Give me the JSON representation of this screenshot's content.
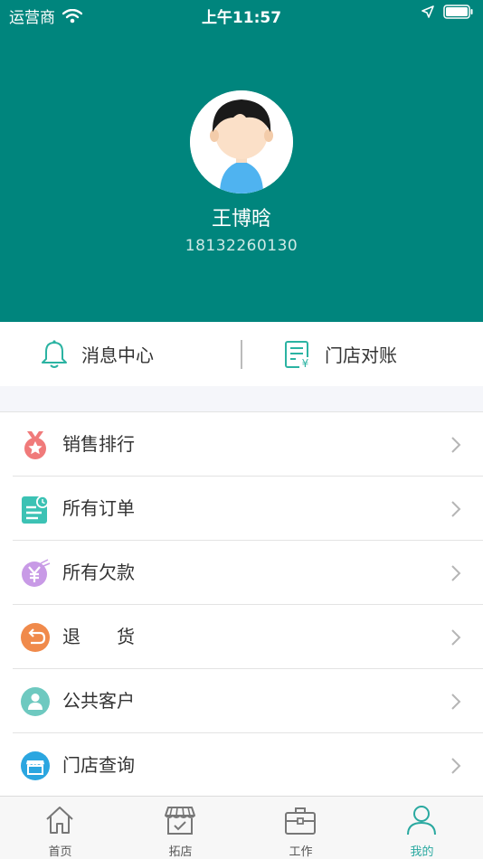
{
  "status_bar": {
    "carrier": "运营商",
    "time": "上午11:57"
  },
  "profile": {
    "name": "王博晗",
    "phone": "18132260130"
  },
  "quick_actions": [
    {
      "label": "消息中心",
      "icon": "bell-icon"
    },
    {
      "label": "门店对账",
      "icon": "statement-icon"
    }
  ],
  "menu": [
    {
      "label": "销售排行",
      "icon": "medal-icon",
      "color": "#f07a7a"
    },
    {
      "label": "所有订单",
      "icon": "order-list-icon",
      "color": "#3cc2b4"
    },
    {
      "label": "所有欠款",
      "icon": "yen-icon",
      "color": "#c89ae6"
    },
    {
      "label": "退　　货",
      "icon": "return-icon",
      "color": "#f08a4b"
    },
    {
      "label": "公共客户",
      "icon": "customer-icon",
      "color": "#6ec9c0"
    },
    {
      "label": "门店查询",
      "icon": "store-search-icon",
      "color": "#2ba6e0"
    }
  ],
  "tabs": [
    {
      "label": "首页",
      "icon": "home-icon"
    },
    {
      "label": "拓店",
      "icon": "shop-icon"
    },
    {
      "label": "工作",
      "icon": "briefcase-icon"
    },
    {
      "label": "我的",
      "icon": "person-icon",
      "active": true
    }
  ],
  "colors": {
    "header": "#00857d",
    "accent": "#2aa9a0"
  }
}
